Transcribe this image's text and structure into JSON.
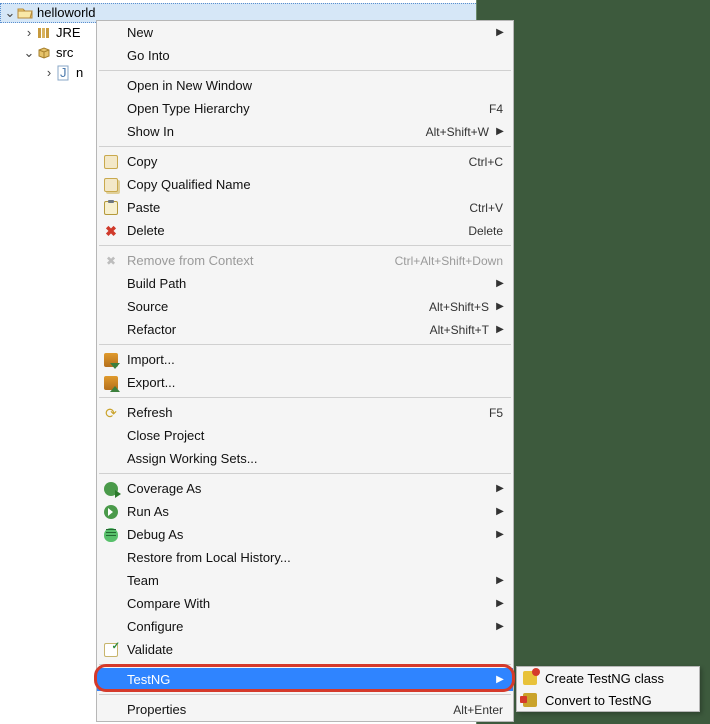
{
  "tree": {
    "project": "helloworld",
    "jre": "JRE",
    "src": "src",
    "srcChild": "n"
  },
  "menu": {
    "new_": {
      "label": "New",
      "sub": true
    },
    "goInto": {
      "label": "Go Into"
    },
    "openNewWin": {
      "label": "Open in New Window"
    },
    "openTypeHier": {
      "label": "Open Type Hierarchy",
      "accel": "F4"
    },
    "showIn": {
      "label": "Show In",
      "accel": "Alt+Shift+W",
      "sub": true
    },
    "copy": {
      "label": "Copy",
      "accel": "Ctrl+C"
    },
    "copyQualified": {
      "label": "Copy Qualified Name"
    },
    "paste": {
      "label": "Paste",
      "accel": "Ctrl+V"
    },
    "delete": {
      "label": "Delete",
      "accel": "Delete"
    },
    "removeCtx": {
      "label": "Remove from Context",
      "accel": "Ctrl+Alt+Shift+Down",
      "disabled": true
    },
    "buildPath": {
      "label": "Build Path",
      "sub": true
    },
    "source": {
      "label": "Source",
      "accel": "Alt+Shift+S",
      "sub": true
    },
    "refactor": {
      "label": "Refactor",
      "accel": "Alt+Shift+T",
      "sub": true
    },
    "import": {
      "label": "Import..."
    },
    "export": {
      "label": "Export..."
    },
    "refresh": {
      "label": "Refresh",
      "accel": "F5"
    },
    "closeProject": {
      "label": "Close Project"
    },
    "assignWS": {
      "label": "Assign Working Sets..."
    },
    "coverageAs": {
      "label": "Coverage As",
      "sub": true
    },
    "runAs": {
      "label": "Run As",
      "sub": true
    },
    "debugAs": {
      "label": "Debug As",
      "sub": true
    },
    "restoreLocal": {
      "label": "Restore from Local History..."
    },
    "team": {
      "label": "Team",
      "sub": true
    },
    "compareWith": {
      "label": "Compare With",
      "sub": true
    },
    "configure": {
      "label": "Configure",
      "sub": true
    },
    "validate": {
      "label": "Validate"
    },
    "testng": {
      "label": "TestNG",
      "sub": true,
      "highlight": true
    },
    "properties": {
      "label": "Properties",
      "accel": "Alt+Enter"
    }
  },
  "submenu": {
    "createClass": "Create TestNG class",
    "convert": "Convert to TestNG"
  }
}
